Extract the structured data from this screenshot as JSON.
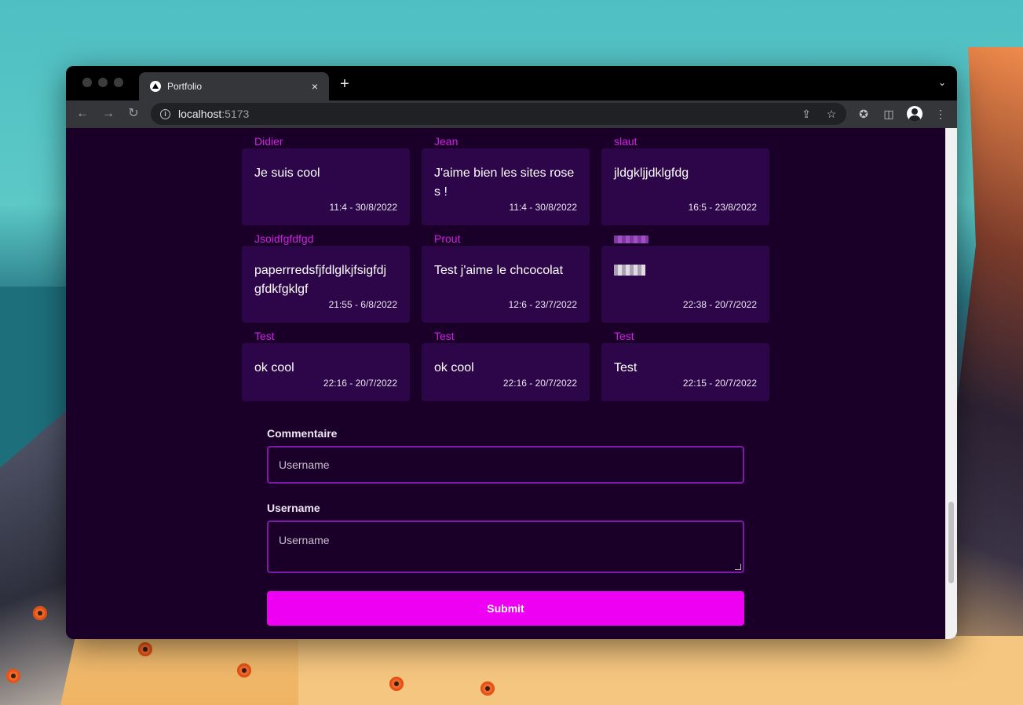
{
  "browser": {
    "tab_title": "Portfolio",
    "tab_close": "×",
    "new_tab": "+",
    "url_host": "localhost",
    "url_port": ":5173"
  },
  "comments": [
    {
      "author": "Didier",
      "text": "Je suis cool",
      "time": "11:4 - 30/8/2022"
    },
    {
      "author": "Jean",
      "text": "J'aime bien les sites rose s !",
      "time": "11:4 - 30/8/2022"
    },
    {
      "author": "slaut",
      "text": "jldgkljjdklgfdg",
      "time": "16:5 - 23/8/2022"
    },
    {
      "author": "Jsoidfgfdfgd",
      "text": "paperrredsfjfdlglkjfsigfdj gfdkfgklgf",
      "time": "21:55 - 6/8/2022"
    },
    {
      "author": "Prout",
      "text": "Test j'aime le chcocolat",
      "time": "12:6 - 23/7/2022"
    },
    {
      "author": "",
      "text": "",
      "time": "22:38 - 20/7/2022"
    },
    {
      "author": "Test",
      "text": "ok cool",
      "time": "22:16 - 20/7/2022"
    },
    {
      "author": "Test",
      "text": "ok cool",
      "time": "22:16 - 20/7/2022"
    },
    {
      "author": "Test",
      "text": "Test",
      "time": "22:15 - 20/7/2022"
    }
  ],
  "form": {
    "comment_label": "Commentaire",
    "comment_placeholder": "Username",
    "username_label": "Username",
    "username_placeholder": "Username",
    "submit_label": "Submit"
  },
  "colors": {
    "page_bg": "#1a0029",
    "card_bg": "#2c0648",
    "author": "#d21ee6",
    "accent": "#ee00f2"
  }
}
